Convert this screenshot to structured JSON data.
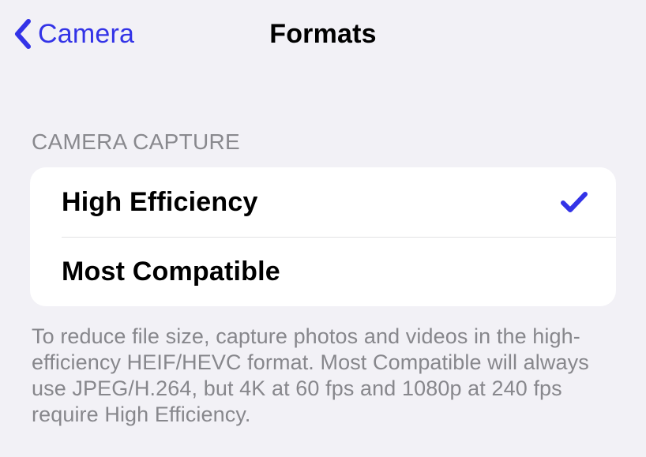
{
  "navbar": {
    "back_label": "Camera",
    "title": "Formats"
  },
  "section": {
    "header": "CAMERA CAPTURE",
    "options": [
      {
        "label": "High Efficiency",
        "selected": true
      },
      {
        "label": "Most Compatible",
        "selected": false
      }
    ],
    "footer": "To reduce file size, capture photos and videos in the high-efficiency HEIF/HEVC format. Most Compatible will always use JPEG/H.264, but 4K at 60 fps and 1080p at 240 fps require High Efficiency."
  },
  "colors": {
    "accent": "#3333e7",
    "background": "#f2f1f6",
    "card": "#ffffff",
    "secondary_text": "#87878c"
  }
}
